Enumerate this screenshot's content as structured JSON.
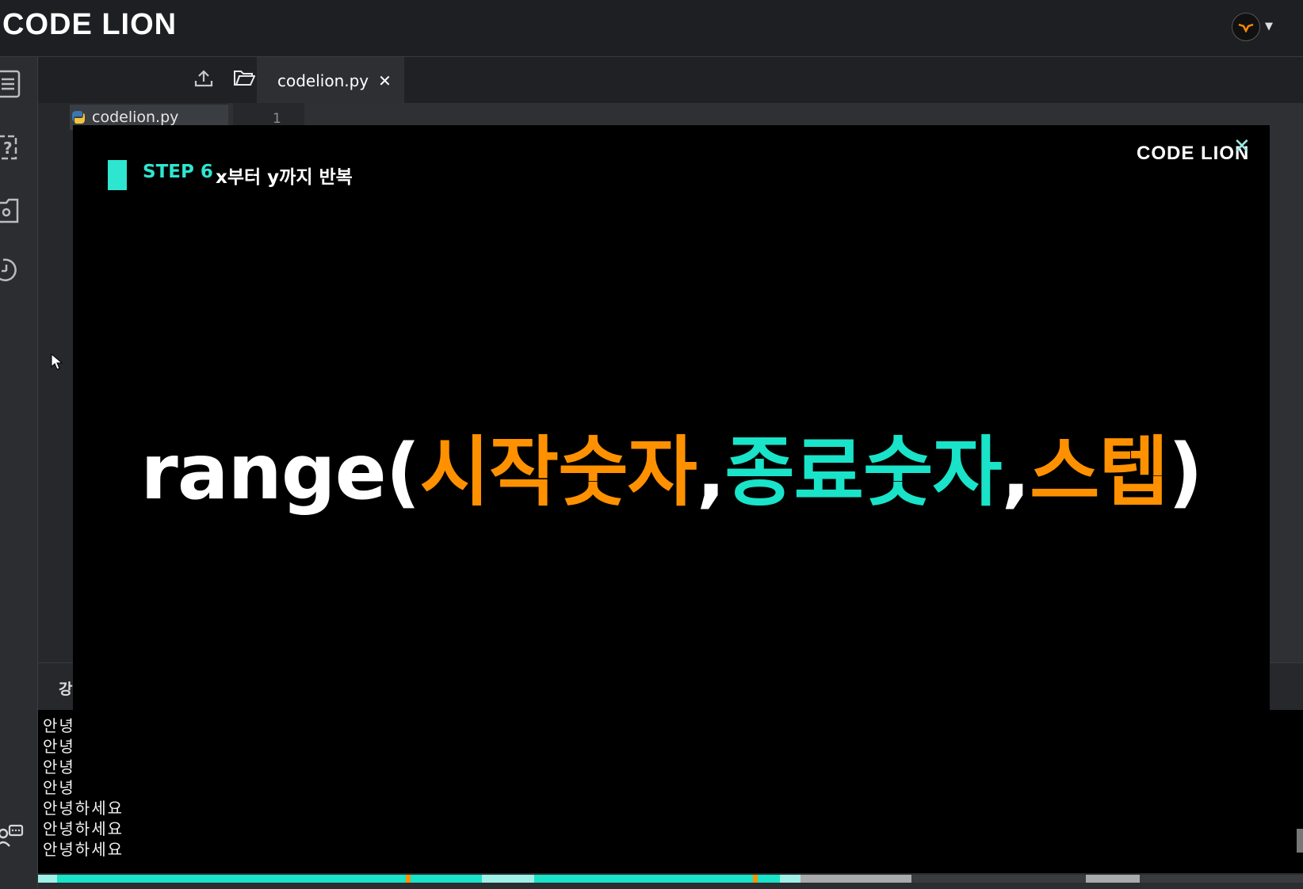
{
  "app": {
    "logo": "CODE LION"
  },
  "explorer": {
    "file_name": "codelion.py"
  },
  "editor": {
    "tab_label": "codelion.py",
    "tab_close": "✕",
    "line_number": "1"
  },
  "console": {
    "header": "강",
    "lines": [
      "안녕",
      "안녕",
      "안녕",
      "안녕",
      "안녕하세요",
      "안녕하세요",
      "안녕하세요"
    ]
  },
  "video": {
    "logo": "CODE LION",
    "close": "✕",
    "step_label": "STEP 6",
    "step_title": "x부터 y까지 반복",
    "formula": {
      "prefix": "range(",
      "arg1": "시작숫자",
      "comma1": ",",
      "arg2": "종료숫자",
      "comma2": ",",
      "arg3": "스텝",
      "suffix": ")"
    }
  },
  "colors": {
    "accent_teal": "#19e3c8",
    "accent_orange": "#ff9100",
    "background_dark": "#1e1f22"
  }
}
